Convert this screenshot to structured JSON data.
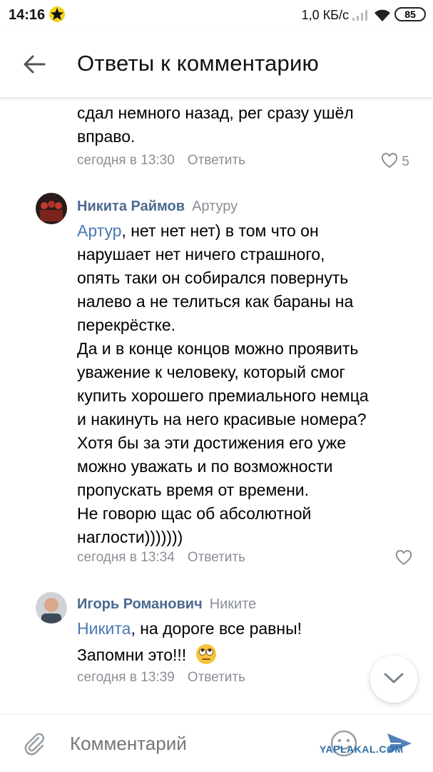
{
  "status_bar": {
    "time": "14:16",
    "network_speed": "1,0 КБ/с",
    "battery": "85"
  },
  "header": {
    "title": "Ответы к комментарию"
  },
  "comments": [
    {
      "text_lines": [
        "сдал немного назад, рег сразу ушёл",
        "вправо."
      ],
      "time": "сегодня в 13:30",
      "reply_label": "Ответить",
      "likes": "5"
    },
    {
      "author": "Никита Раймов",
      "to": "Артуру",
      "mention": "Артур",
      "first_line_rest": ", нет нет нет) в том что он",
      "text_lines": [
        "нарушает нет ничего страшного,",
        "опять таки он собирался повернуть",
        "налево а не телиться как бараны на",
        "перекрёстке.",
        "Да и в конце концов можно проявить",
        "уважение к человеку, который смог",
        "купить хорошего премиального немца",
        "и накинуть на него красивые номера?",
        "Хотя бы за эти достижения его уже",
        "можно уважать и по возможности",
        "пропускать время от времени.",
        "Не говорю щас об абсолютной",
        "наглости)))))))"
      ],
      "time": "сегодня в 13:34",
      "reply_label": "Ответить"
    },
    {
      "author": "Игорь Романович",
      "to": "Никите",
      "mention": "Никита",
      "first_line_rest": ", на дороге все равны!",
      "second_line": "Запомни это!!!",
      "time": "сегодня в 13:39",
      "reply_label": "Ответить"
    }
  ],
  "composer": {
    "placeholder": "Комментарий"
  },
  "watermark": "YAPLAKAL.COM",
  "colors": {
    "link": "#4a79b5",
    "author": "#4a6a8f",
    "meta": "#8a8f96",
    "send": "#5181b8"
  }
}
